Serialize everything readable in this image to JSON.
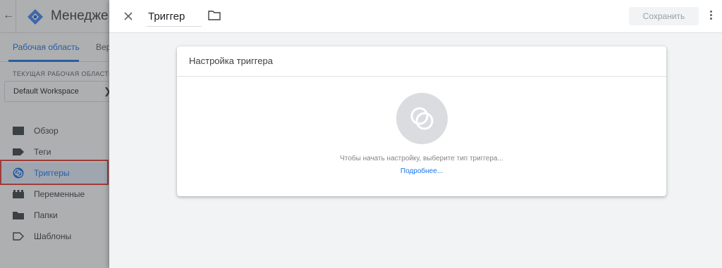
{
  "app": {
    "title": "Менеджер",
    "back_icon": "arrow-back-icon",
    "tabs": [
      {
        "label": "Рабочая область"
      },
      {
        "label": "Вер"
      }
    ],
    "workspace": {
      "section_label": "ТЕКУЩАЯ РАБОЧАЯ ОБЛАСТЬ",
      "name": "Default Workspace"
    },
    "nav": [
      {
        "label": "Обзор",
        "icon": "overview-icon"
      },
      {
        "label": "Теги",
        "icon": "tag-icon"
      },
      {
        "label": "Триггеры",
        "icon": "trigger-icon",
        "active": true
      },
      {
        "label": "Переменные",
        "icon": "variables-icon"
      },
      {
        "label": "Папки",
        "icon": "folder-icon"
      },
      {
        "label": "Шаблоны",
        "icon": "template-icon"
      }
    ]
  },
  "panel": {
    "name_value": "Триггер",
    "save_label": "Сохранить",
    "card": {
      "title": "Настройка триггера",
      "hint": "Чтобы начать настройку, выберите тип триггера...",
      "link": "Подробнее..."
    }
  },
  "colors": {
    "accent": "#1a73e8",
    "highlight_border": "#e53935",
    "panel_bg": "#f1f3f4"
  }
}
